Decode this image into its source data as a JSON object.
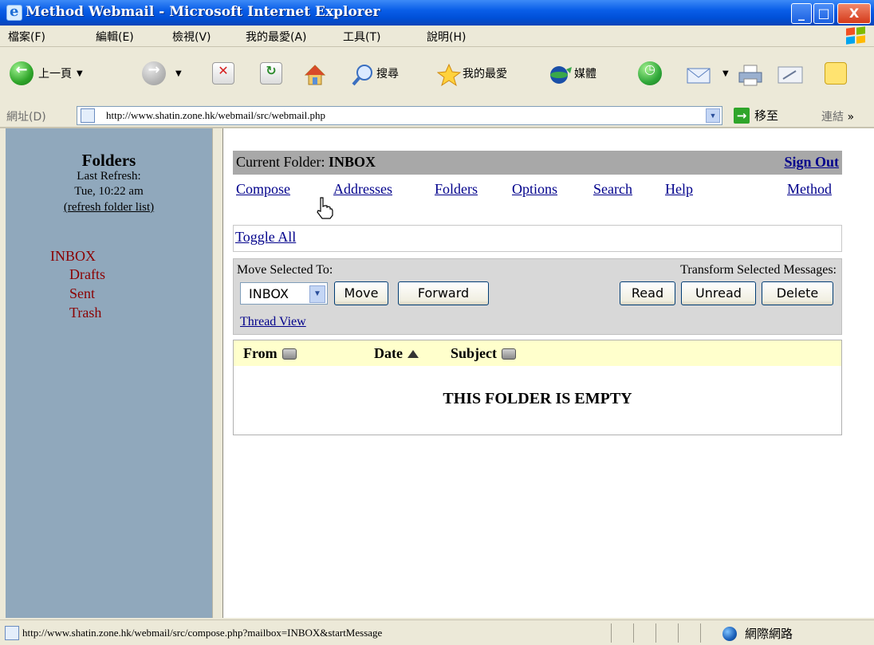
{
  "window": {
    "title": "Method Webmail - Microsoft Internet Explorer",
    "controls": {
      "minimize": "_",
      "maximize": "□",
      "close": "X"
    }
  },
  "menu": {
    "items": [
      "檔案(F)",
      "編輯(E)",
      "檢視(V)",
      "我的最愛(A)",
      "工具(T)",
      "說明(H)"
    ]
  },
  "toolbar": {
    "back_label": "上一頁",
    "search_label": "搜尋",
    "favorites_label": "我的最愛",
    "media_label": "媒體"
  },
  "address": {
    "label": "網址(D)",
    "url": "http://www.shatin.zone.hk/webmail/src/webmail.php",
    "go_label": "移至",
    "links_label": "連結",
    "more": "»"
  },
  "sidebar": {
    "heading": "Folders",
    "last_refresh_label": "Last Refresh:",
    "last_refresh_value": "Tue, 10:22 am",
    "refresh_link": "(refresh folder list)",
    "folders": [
      "INBOX",
      "Drafts",
      "Sent",
      "Trash"
    ]
  },
  "main": {
    "current_folder_label": "Current Folder:",
    "current_folder": "INBOX",
    "sign_out": "Sign Out",
    "nav": [
      "Compose",
      "Addresses",
      "Folders",
      "Options",
      "Search",
      "Help"
    ],
    "method_link": "Method",
    "toggle_all": "Toggle All",
    "move_selected_label": "Move Selected To:",
    "move_select_value": "INBOX",
    "move_button": "Move",
    "forward_button": "Forward",
    "transform_label": "Transform Selected Messages:",
    "read_button": "Read",
    "unread_button": "Unread",
    "delete_button": "Delete",
    "thread_view": "Thread View",
    "columns": [
      "From",
      "Date",
      "Subject"
    ],
    "empty_message": "THIS FOLDER IS EMPTY"
  },
  "status": {
    "text": "http://www.shatin.zone.hk/webmail/src/compose.php?mailbox=INBOX&startMessage",
    "zone": "網際網路"
  }
}
